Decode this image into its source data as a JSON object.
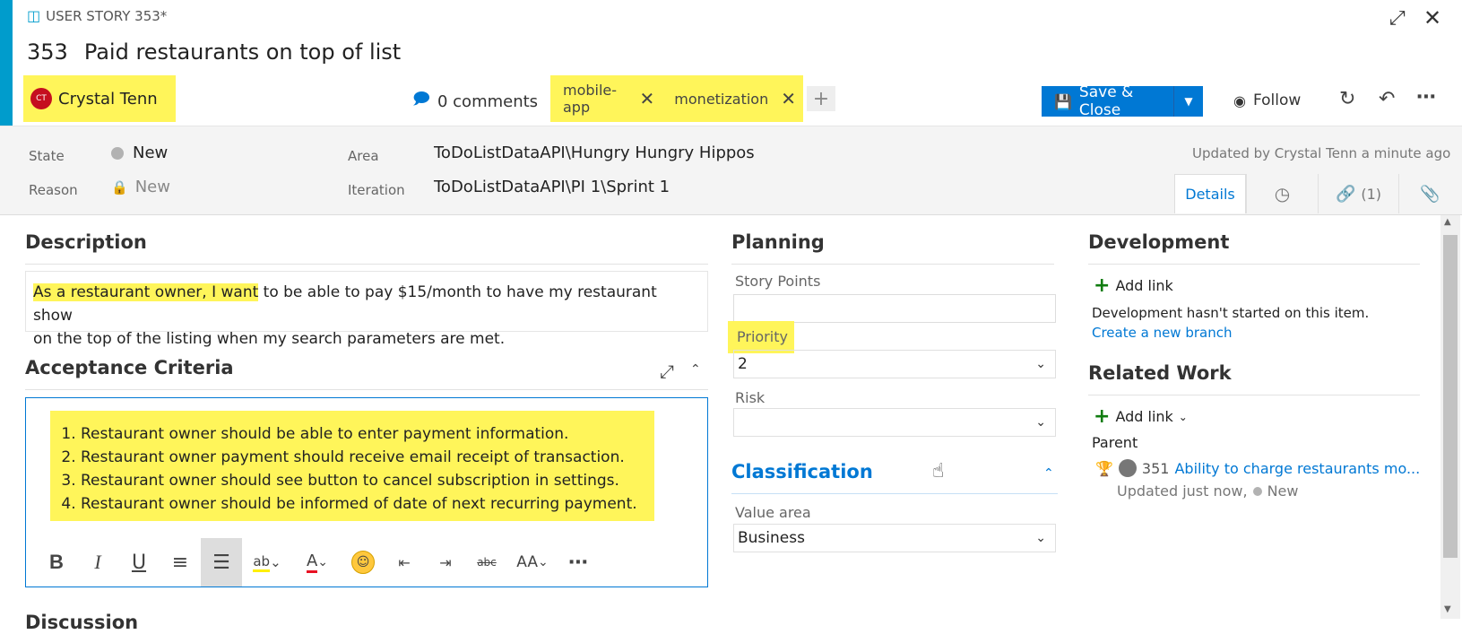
{
  "header": {
    "work_item_type": "USER STORY 353*",
    "id": "353",
    "title": "Paid restaurants on top of list",
    "assignee_initials": "CT",
    "assignee_name": "Crystal Tenn",
    "comments_label": "0 comments",
    "tags": [
      "mobile-app",
      "monetization"
    ],
    "add_tag": "+",
    "save_label": "Save & Close",
    "follow_label": "Follow"
  },
  "fields": {
    "state_label": "State",
    "state_value": "New",
    "reason_label": "Reason",
    "reason_value": "New",
    "area_label": "Area",
    "area_value": "ToDoListDataAPI\\Hungry Hungry Hippos",
    "iteration_label": "Iteration",
    "iteration_value": "ToDoListDataAPI\\PI 1\\Sprint 1",
    "updated_text": "Updated by Crystal Tenn a minute ago"
  },
  "tabs": {
    "details": "Details",
    "links_count": "(1)"
  },
  "description": {
    "title": "Description",
    "highlight": "As a restaurant owner, I want",
    "rest_line1": " to be able to pay $15/month to have my restaurant show",
    "line2": "on the top of the listing when my search parameters are met."
  },
  "acceptance": {
    "title": "Acceptance Criteria",
    "items": [
      "Restaurant owner should be able to enter payment information.",
      "Restaurant owner payment should receive email receipt of transaction.",
      "Restaurant owner should see button to cancel subscription in settings.",
      "Restaurant owner should be informed of date of next recurring payment."
    ],
    "discussion_partial": "Discussion"
  },
  "planning": {
    "title": "Planning",
    "story_points_label": "Story Points",
    "story_points_value": "",
    "priority_label": "Priority",
    "priority_value": "2",
    "risk_label": "Risk",
    "risk_value": ""
  },
  "classification": {
    "title": "Classification",
    "value_area_label": "Value area",
    "value_area_value": "Business"
  },
  "development": {
    "title": "Development",
    "add_link": "Add link",
    "status_text": "Development hasn't started on this item.",
    "create_branch": "Create a new branch"
  },
  "related": {
    "title": "Related Work",
    "add_link": "Add link",
    "parent_label": "Parent",
    "parent_id": "351",
    "parent_title": "Ability to charge restaurants mo...",
    "parent_updated": "Updated just now,",
    "parent_state": "New"
  },
  "colors": {
    "accent": "#009ccc",
    "primary": "#0078d4",
    "highlight": "#fff55a",
    "add_green": "#107c10"
  },
  "icons": [
    "book-icon",
    "expand-icon",
    "close-icon",
    "comments-icon",
    "save-icon",
    "eye-icon",
    "refresh-icon",
    "undo-icon",
    "more-icon",
    "history-icon",
    "link-icon",
    "attachment-icon",
    "lock-icon",
    "trophy-icon",
    "user-story-icon"
  ]
}
